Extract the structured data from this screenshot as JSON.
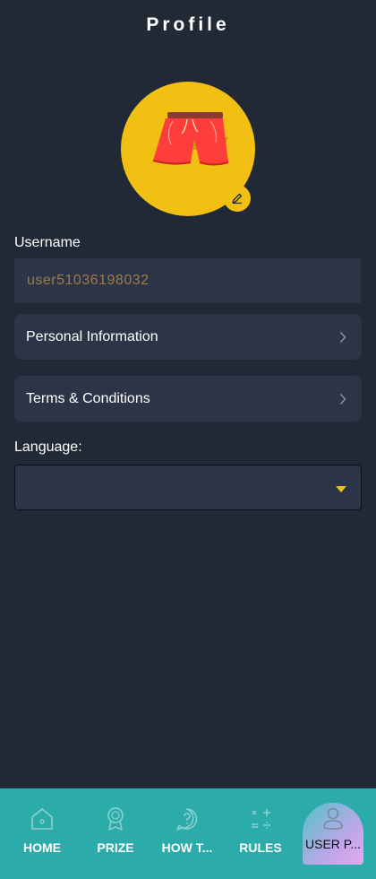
{
  "header": {
    "title": "Profile"
  },
  "avatar": {
    "image": "red-shorts",
    "edit_icon": "pencil-icon"
  },
  "username": {
    "label": "Username",
    "value": "user51036198032"
  },
  "menu": [
    {
      "label": "Personal Information",
      "icon": "chevron-right-icon"
    },
    {
      "label": "Terms & Conditions",
      "icon": "chevron-right-icon"
    }
  ],
  "language": {
    "label": "Language:",
    "selected": ""
  },
  "nav": {
    "items": [
      {
        "label": "HOME",
        "icon": "home-icon"
      },
      {
        "label": "PRIZE",
        "icon": "award-icon"
      },
      {
        "label": "HOW T...",
        "icon": "help-icon"
      },
      {
        "label": "RULES",
        "icon": "rules-icon"
      },
      {
        "label": "USER P...",
        "icon": "user-icon",
        "active": true
      }
    ]
  },
  "colors": {
    "background": "#222936",
    "card": "#2c3547",
    "accent": "#f2c012",
    "nav": "#2bacaa",
    "username_text": "#a07a46"
  }
}
